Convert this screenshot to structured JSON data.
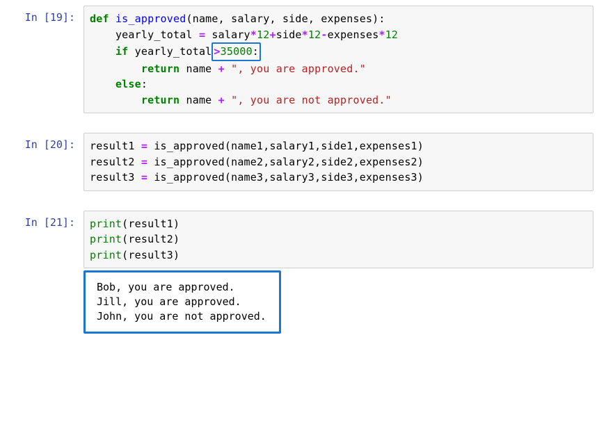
{
  "cells": [
    {
      "prompt": "In [19]:",
      "code": {
        "tokens": [
          [
            "kw",
            "def"
          ],
          [
            "sp",
            " "
          ],
          [
            "def",
            "is_approved"
          ],
          [
            "id",
            "(name, salary, side, expenses):"
          ],
          [
            "nl",
            ""
          ],
          [
            "sp",
            "    "
          ],
          [
            "id",
            "yearly_total "
          ],
          [
            "op",
            "="
          ],
          [
            "id",
            " salary"
          ],
          [
            "op",
            "*"
          ],
          [
            "num",
            "12"
          ],
          [
            "op",
            "+"
          ],
          [
            "id",
            "side"
          ],
          [
            "op",
            "*"
          ],
          [
            "num",
            "12"
          ],
          [
            "op",
            "-"
          ],
          [
            "id",
            "expenses"
          ],
          [
            "op",
            "*"
          ],
          [
            "num",
            "12"
          ],
          [
            "nl",
            ""
          ],
          [
            "sp",
            "    "
          ],
          [
            "kw",
            "if"
          ],
          [
            "id",
            " yearly_total"
          ],
          [
            "hl1_open",
            ""
          ],
          [
            "op",
            ">"
          ],
          [
            "num",
            "35000"
          ],
          [
            "id",
            ":"
          ],
          [
            "hl1_close",
            ""
          ],
          [
            "nl",
            ""
          ],
          [
            "sp",
            "        "
          ],
          [
            "kw",
            "return"
          ],
          [
            "id",
            " name "
          ],
          [
            "op",
            "+"
          ],
          [
            "id",
            " "
          ],
          [
            "str",
            "\", you are approved.\""
          ],
          [
            "nl",
            ""
          ],
          [
            "sp",
            "    "
          ],
          [
            "kw",
            "else"
          ],
          [
            "id",
            ":"
          ],
          [
            "nl",
            ""
          ],
          [
            "sp",
            "        "
          ],
          [
            "kw",
            "return"
          ],
          [
            "id",
            " name "
          ],
          [
            "op",
            "+"
          ],
          [
            "id",
            " "
          ],
          [
            "str",
            "\", you are not approved.\""
          ]
        ]
      }
    },
    {
      "prompt": "In [20]:",
      "code": {
        "tokens": [
          [
            "id",
            "result1 "
          ],
          [
            "op",
            "="
          ],
          [
            "id",
            " is_approved(name1,salary1,side1,expenses1)"
          ],
          [
            "nl",
            ""
          ],
          [
            "id",
            "result2 "
          ],
          [
            "op",
            "="
          ],
          [
            "id",
            " is_approved(name2,salary2,side2,expenses2)"
          ],
          [
            "nl",
            ""
          ],
          [
            "id",
            "result3 "
          ],
          [
            "op",
            "="
          ],
          [
            "id",
            " is_approved(name3,salary3,side3,expenses3)"
          ]
        ]
      }
    },
    {
      "prompt": "In [21]:",
      "code": {
        "tokens": [
          [
            "bn",
            "print"
          ],
          [
            "id",
            "(result1)"
          ],
          [
            "nl",
            ""
          ],
          [
            "bn",
            "print"
          ],
          [
            "id",
            "(result2)"
          ],
          [
            "nl",
            ""
          ],
          [
            "bn",
            "print"
          ],
          [
            "id",
            "(result3)"
          ]
        ]
      },
      "output_lines": [
        "Bob, you are approved.",
        "Jill, you are approved.",
        "John, you are not approved."
      ]
    }
  ]
}
